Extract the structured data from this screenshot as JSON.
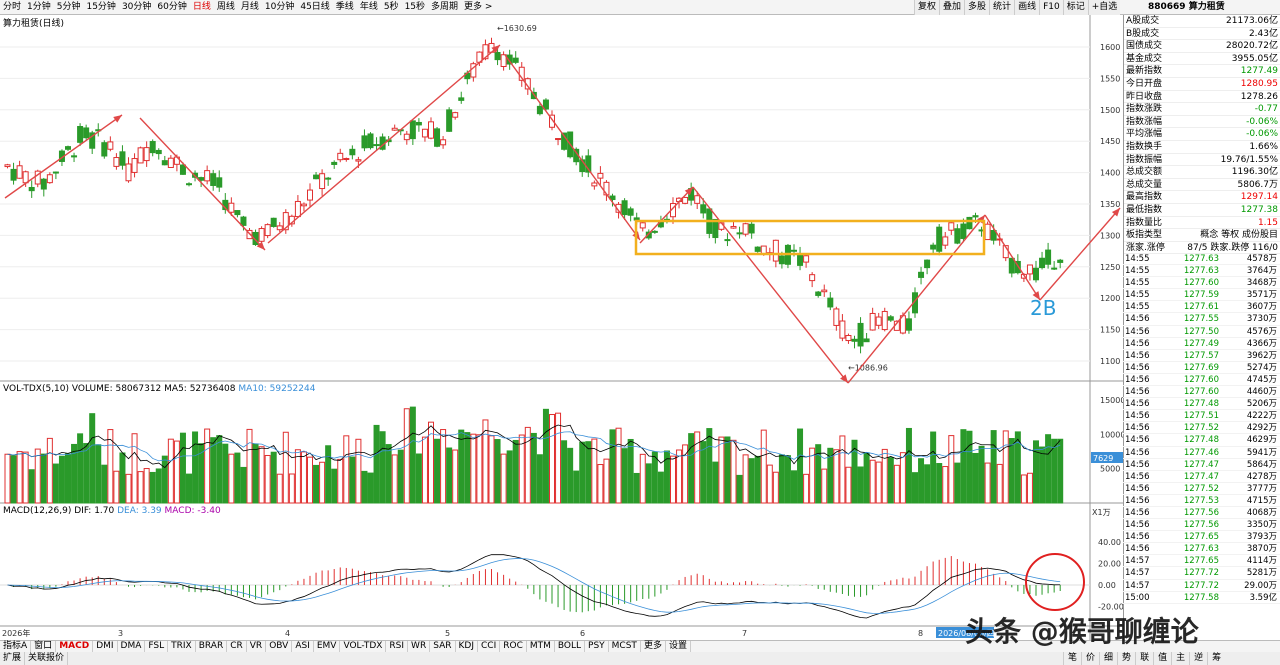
{
  "periods": [
    "分时",
    "1分钟",
    "5分钟",
    "15分钟",
    "30分钟",
    "60分钟",
    "日线",
    "周线",
    "月线",
    "10分钟",
    "45日线",
    "季线",
    "年线",
    "5秒",
    "15秒",
    "多周期",
    "更多 >"
  ],
  "active_period": "日线",
  "tools": [
    "复权",
    "叠加",
    "多股",
    "统计",
    "画线",
    "F10",
    "标记",
    "+自选"
  ],
  "title_right": "880669 算力租赁",
  "chart_title": "算力租赁(日线)",
  "price_axis": [
    "1600",
    "1550",
    "1500",
    "1450",
    "1400",
    "1350",
    "1300",
    "1250",
    "1200",
    "1150",
    "1100"
  ],
  "max_label": "1630.69",
  "min_label": "1086.96",
  "annotation": "2B",
  "vol_label": {
    "name": "VOL-TDX(5,10)",
    "volume": "VOLUME: 58067312",
    "ma5": "MA5: 52736408",
    "ma10": "MA10: 59252244"
  },
  "vol_axis": [
    "15000",
    "10000",
    "5000"
  ],
  "vol_current": "7629",
  "vol_unit": "X1万",
  "macd_label": {
    "name": "MACD(12,26,9)",
    "dif": "DIF: 1.70",
    "dea": "DEA: 3.39",
    "macd": "MACD: -3.40"
  },
  "macd_axis": [
    "40.00",
    "20.00",
    "0.00",
    "-20.00"
  ],
  "month_labels": [
    "2026年",
    "3",
    "4",
    "5",
    "6",
    "7",
    "8"
  ],
  "date_badge": "2026/08/06/四",
  "quote": [
    {
      "k": "A股成交",
      "v": "21173.06亿",
      "c": ""
    },
    {
      "k": "B股成交",
      "v": "2.43亿",
      "c": ""
    },
    {
      "k": "国债成交",
      "v": "28020.72亿",
      "c": ""
    },
    {
      "k": "基金成交",
      "v": "3955.05亿",
      "c": ""
    },
    {
      "k": "最新指数",
      "v": "1277.49",
      "c": "green"
    },
    {
      "k": "今日开盘",
      "v": "1280.95",
      "c": "red"
    },
    {
      "k": "昨日收盘",
      "v": "1278.26",
      "c": ""
    },
    {
      "k": "指数涨跌",
      "v": "-0.77",
      "c": "green"
    },
    {
      "k": "指数涨幅",
      "v": "-0.06%",
      "c": "green"
    },
    {
      "k": "平均涨幅",
      "v": "-0.06%",
      "c": "green"
    },
    {
      "k": "指数换手",
      "v": "1.66%",
      "c": ""
    },
    {
      "k": "指数振幅",
      "v": "19.76/1.55%",
      "c": ""
    },
    {
      "k": "总成交额",
      "v": "1196.30亿",
      "c": ""
    },
    {
      "k": "总成交量",
      "v": "5806.7万",
      "c": ""
    },
    {
      "k": "最高指数",
      "v": "1297.14",
      "c": "red"
    },
    {
      "k": "最低指数",
      "v": "1277.38",
      "c": "green"
    },
    {
      "k": "指数量比",
      "v": "1.15",
      "c": "red"
    },
    {
      "k": "板指类型",
      "v": "概念 等权 成份股目",
      "c": ""
    },
    {
      "k": "涨家.涨停",
      "v": "87/5 跌家.跌停 116/0",
      "c": ""
    }
  ],
  "ticks": [
    [
      "14:55",
      "1277.63",
      "4578万"
    ],
    [
      "14:55",
      "1277.63",
      "3764万"
    ],
    [
      "14:55",
      "1277.60",
      "3468万"
    ],
    [
      "14:55",
      "1277.59",
      "3571万"
    ],
    [
      "14:55",
      "1277.61",
      "3607万"
    ],
    [
      "14:56",
      "1277.55",
      "3730万"
    ],
    [
      "14:56",
      "1277.50",
      "4576万"
    ],
    [
      "14:56",
      "1277.49",
      "4366万"
    ],
    [
      "14:56",
      "1277.57",
      "3962万"
    ],
    [
      "14:56",
      "1277.69",
      "5274万"
    ],
    [
      "14:56",
      "1277.60",
      "4745万"
    ],
    [
      "14:56",
      "1277.60",
      "4460万"
    ],
    [
      "14:56",
      "1277.48",
      "5206万"
    ],
    [
      "14:56",
      "1277.51",
      "4222万"
    ],
    [
      "14:56",
      "1277.52",
      "4292万"
    ],
    [
      "14:56",
      "1277.48",
      "4629万"
    ],
    [
      "14:56",
      "1277.46",
      "5941万"
    ],
    [
      "14:56",
      "1277.47",
      "5864万"
    ],
    [
      "14:56",
      "1277.47",
      "4278万"
    ],
    [
      "14:56",
      "1277.52",
      "3777万"
    ],
    [
      "14:56",
      "1277.53",
      "4715万"
    ],
    [
      "14:56",
      "1277.56",
      "4068万"
    ],
    [
      "14:56",
      "1277.56",
      "3350万"
    ],
    [
      "14:56",
      "1277.65",
      "3793万"
    ],
    [
      "14:56",
      "1277.63",
      "3870万"
    ],
    [
      "14:57",
      "1277.65",
      "4114万"
    ],
    [
      "14:57",
      "1277.72",
      "5281万"
    ],
    [
      "14:57",
      "1277.72",
      "29.00万"
    ],
    [
      "15:00",
      "1277.58",
      "3.59亿"
    ]
  ],
  "bottom_tabs": [
    "指标A",
    "窗口",
    "MACD",
    "DMI",
    "DMA",
    "FSL",
    "TRIX",
    "BRAR",
    "CR",
    "VR",
    "OBV",
    "ASI",
    "EMV",
    "VOL-TDX",
    "RSI",
    "WR",
    "SAR",
    "KDJ",
    "CCI",
    "ROC",
    "MTM",
    "BOLL",
    "PSY",
    "MCST",
    "更多",
    "设置"
  ],
  "active_tab": "MACD",
  "bottom2": [
    "扩展",
    "关联报价"
  ],
  "bottom_right": [
    "笔",
    "价",
    "细",
    "势",
    "联",
    "值",
    "主",
    "逆",
    "筹"
  ],
  "watermark": "头条 @猴哥聊缠论",
  "colors": {
    "up": "#e03030",
    "down": "#2a9a2a",
    "box": "#f2b01e",
    "arrow": "#e04848",
    "circle": "#e02020",
    "dif": "#000000",
    "dea": "#3a8fd8",
    "annotation": "#2a9ad8"
  }
}
